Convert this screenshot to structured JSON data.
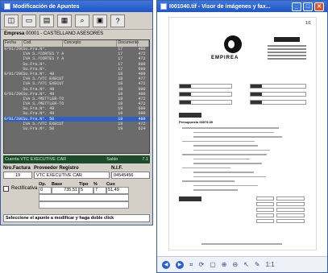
{
  "left_window": {
    "title": "Modificación de Apuntes",
    "empresa_label": "Empresa",
    "empresa_value": "00001 - CASTELLANO ASESORES",
    "columns": [
      "Fecha",
      "Cod.",
      "Concepto",
      "Documento",
      ""
    ],
    "rows": [
      [
        "9/01/2006",
        "Su.Fra.Nº.",
        "",
        "17",
        "400"
      ],
      [
        "",
        "IVA S./CORTES Y APLANADOS MET",
        "",
        "17",
        "472"
      ],
      [
        "",
        "IVA S./CORTES Y APLANADOS MET",
        "",
        "17",
        "472"
      ],
      [
        "",
        "Su.Fra.Nº.",
        "",
        "17",
        "600"
      ],
      [
        "",
        "Su.Fra.Nº.",
        "",
        "17",
        "600"
      ],
      [
        "9/01/2006",
        "Su.Fra.Nº. 48",
        "",
        "18",
        "400"
      ],
      [
        "",
        "IVA S./VTC EXECUTIVE CAR",
        "",
        "18",
        "477"
      ],
      [
        "",
        "IVA S./VTC EXECUTIVE CAR",
        "",
        "18",
        "472"
      ],
      [
        "",
        "Su.Fra.Nº. 48",
        "",
        "18",
        "600"
      ],
      [
        "9/01/2006",
        "Su.Fra.Nº. 49",
        "",
        "19",
        "400"
      ],
      [
        "",
        "IVA S./METTLER-TOLEDO S.A.E",
        "",
        "19",
        "472"
      ],
      [
        "",
        "IVA S./METTLER-TOLEDO S.A.E",
        "",
        "19",
        "472"
      ],
      [
        "",
        "Su.Fra.Nº. 49",
        "",
        "19",
        "600"
      ],
      [
        "",
        "Su.Fra.Nº. 49",
        "",
        "19",
        "600"
      ],
      [
        "9/01/2006",
        "Su.Fra.Nº. 50",
        "",
        "19",
        "400"
      ],
      [
        "",
        "IVA S./VTC EXECUTIVE CAR",
        "",
        "19",
        "472"
      ],
      [
        "",
        "Su.Fra.Nº. 50",
        "",
        "19",
        "624"
      ]
    ],
    "selected_row": 14,
    "cuenta_label": "Cuenta VTC EXECUTIVE CAR",
    "saldo_label": "Saldo",
    "saldo_value": "7.1",
    "nro_factura_label": "Nro.Factura",
    "nro_factura_value": "19",
    "proveedor_label": "Proveedor Registro",
    "proveedor_value": "VTC EXECUTIVE CAR",
    "nif_label": "N.I.F.",
    "nif_value": "04545456",
    "rectificativa_label": "Rectificativa",
    "rectificativa_value": "5",
    "line_headers": [
      "Op.",
      "Base",
      "Tipo",
      "%",
      "Cuo"
    ],
    "line_row": [
      "0",
      "735,51",
      "5",
      "7",
      "51,49"
    ],
    "status_text": "Seleccione el apunte a modificar y haga doble click"
  },
  "right_window": {
    "title": "I001040.tif - Visor de imágenes y fax...",
    "doc_brand": "EMPIREA",
    "page_corner": "1/1",
    "section_title": "Presupuesto 00075.09",
    "zoom_label": "1:1"
  }
}
